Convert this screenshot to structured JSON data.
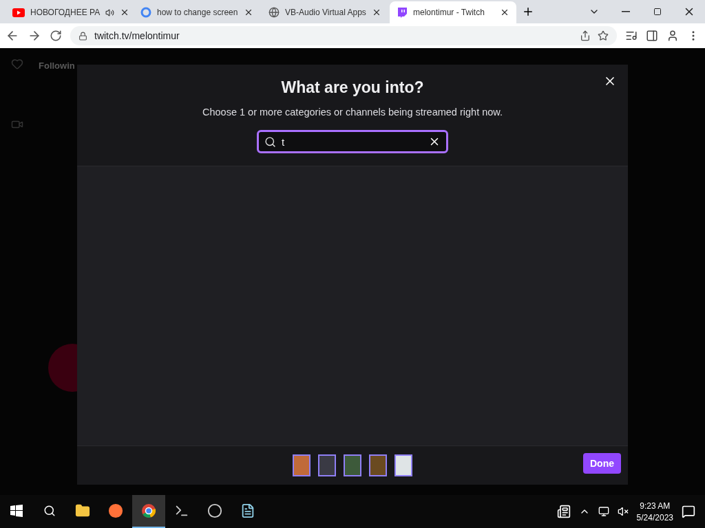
{
  "browser": {
    "tabs": [
      {
        "title": "НОВОГОДНЕЕ РА",
        "kind": "youtube",
        "audio": true,
        "selected": false
      },
      {
        "title": "how to change screen",
        "kind": "google",
        "audio": false,
        "selected": false
      },
      {
        "title": "VB-Audio Virtual Apps",
        "kind": "globe",
        "audio": false,
        "selected": false
      },
      {
        "title": "melontimur - Twitch",
        "kind": "twitch",
        "audio": false,
        "selected": true
      }
    ],
    "address": "twitch.tv/melontimur"
  },
  "background_page": {
    "nav": [
      "Followin"
    ]
  },
  "modal": {
    "title": "What are you into?",
    "subtitle": "Choose 1 or more categories or channels being streamed right now.",
    "search": {
      "value": "t"
    },
    "thumbnails": [
      {
        "color": "#c06a3a"
      },
      {
        "color": "#3a3a44"
      },
      {
        "color": "#3d5a3a"
      },
      {
        "color": "#6a4a20"
      },
      {
        "color": "#dfe4e6"
      }
    ],
    "done": "Done"
  },
  "taskbar": {
    "apps": [
      {
        "kind": "folder",
        "selected": false
      },
      {
        "kind": "firefox",
        "selected": false
      },
      {
        "kind": "chrome",
        "selected": true
      },
      {
        "kind": "terminal",
        "selected": false
      },
      {
        "kind": "obs",
        "selected": false
      },
      {
        "kind": "notepad",
        "selected": false
      }
    ],
    "time": "9:23 AM",
    "date": "5/24/2023"
  }
}
